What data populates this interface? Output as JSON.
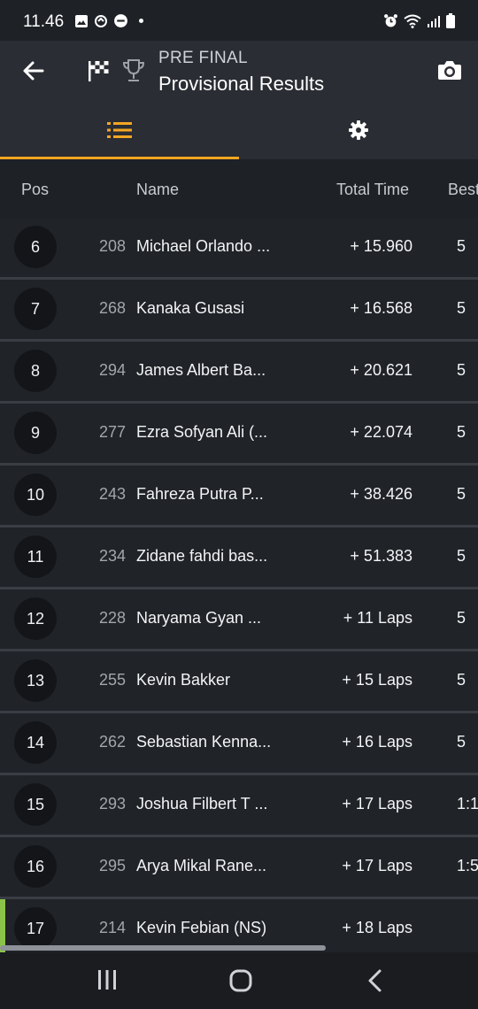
{
  "status_bar": {
    "time": "11.46",
    "left_icons": [
      "image-icon",
      "gesture-icon",
      "messenger-icon",
      "dot"
    ],
    "right_icons": [
      "alarm-icon",
      "wifi-icon",
      "signal-icon",
      "battery-icon"
    ]
  },
  "appbar": {
    "subtitle": "PRE FINAL",
    "title": "Provisional Results",
    "back_icon": "arrow-left",
    "camera_icon": "camera"
  },
  "tabs": [
    {
      "icon": "list",
      "active": true
    },
    {
      "icon": "gear",
      "active": false
    }
  ],
  "colors": {
    "accent": "#f5a623",
    "leader": "#8bc34a",
    "background": "#1e2126"
  },
  "table": {
    "columns": {
      "pos": "Pos",
      "name": "Name",
      "total": "Total Time",
      "best": "Best"
    },
    "rows": [
      {
        "pos": "6",
        "num": "208",
        "name": "Michael Orlando ...",
        "total": "+ 15.960",
        "best": "5"
      },
      {
        "pos": "7",
        "num": "268",
        "name": "Kanaka Gusasi",
        "total": "+ 16.568",
        "best": "5"
      },
      {
        "pos": "8",
        "num": "294",
        "name": "James Albert Ba...",
        "total": "+ 20.621",
        "best": "5"
      },
      {
        "pos": "9",
        "num": "277",
        "name": "Ezra Sofyan Ali (...",
        "total": "+ 22.074",
        "best": "5"
      },
      {
        "pos": "10",
        "num": "243",
        "name": "Fahreza Putra P...",
        "total": "+ 38.426",
        "best": "5"
      },
      {
        "pos": "11",
        "num": "234",
        "name": "Zidane fahdi bas...",
        "total": "+ 51.383",
        "best": "5"
      },
      {
        "pos": "12",
        "num": "228",
        "name": "Naryama Gyan ...",
        "total": "+ 11 Laps",
        "best": "5"
      },
      {
        "pos": "13",
        "num": "255",
        "name": "Kevin Bakker",
        "total": "+ 15 Laps",
        "best": "5"
      },
      {
        "pos": "14",
        "num": "262",
        "name": "Sebastian Kenna...",
        "total": "+ 16 Laps",
        "best": "5"
      },
      {
        "pos": "15",
        "num": "293",
        "name": "Joshua Filbert T ...",
        "total": "+ 17 Laps",
        "best": "1:1"
      },
      {
        "pos": "16",
        "num": "295",
        "name": "Arya Mikal Rane...",
        "total": "+ 17 Laps",
        "best": "1:5"
      },
      {
        "pos": "17",
        "num": "214",
        "name": "Kevin Febian (NS)",
        "total": "+ 18 Laps",
        "best": ""
      }
    ]
  }
}
